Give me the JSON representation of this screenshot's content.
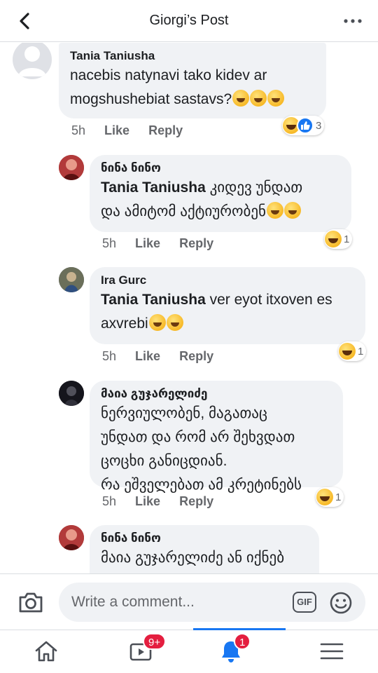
{
  "header": {
    "title": "Giorgi’s Post"
  },
  "comments": [
    {
      "author": "Tania Taniusha",
      "text_line1": "nacebis natynavi tako kidev ar",
      "text_line2": "mogshushebiat sastavs?",
      "time": "5h",
      "like": "Like",
      "reply": "Reply",
      "reaction_count": "3"
    },
    {
      "author": "ნინა ნინო",
      "tag": "Tania Taniusha",
      "text_line1": "კიდევ უნდათ",
      "text_line2": "და ამიტომ აქტიურობენ",
      "time": "5h",
      "like": "Like",
      "reply": "Reply",
      "reaction_count": "1"
    },
    {
      "author": "Ira Gurc",
      "tag": "Tania Taniusha",
      "text_line1": "ver eyot itxoven es",
      "text_line2": "axvrebi",
      "time": "5h",
      "like": "Like",
      "reply": "Reply",
      "reaction_count": "1"
    },
    {
      "author": "მაია გუჯარელიძე",
      "text_line1": "ნერვიულობენ, მაგათაც",
      "text_line2": "უნდათ და რომ არ შეხვდათ",
      "text_line3": "ცოცხი განიცდიან.",
      "text_line4": "რა ეშველებათ ამ კრეტინებს",
      "time": "5h",
      "like": "Like",
      "reply": "Reply",
      "reaction_count": "1"
    },
    {
      "author": "ნინა ნინო",
      "text_line1": "მაია გუჯარელიძე ან იქნებ"
    }
  ],
  "composer": {
    "placeholder": "Write a comment...",
    "gif_label": "GIF"
  },
  "nav": {
    "watch_badge": "9+",
    "notifications_badge": "1"
  },
  "colors": {
    "accent": "#1877f2",
    "bubble": "#f0f2f5",
    "badge": "#e41e3f"
  }
}
